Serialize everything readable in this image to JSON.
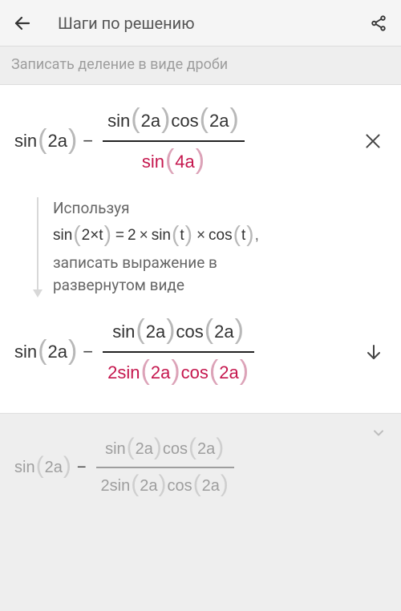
{
  "header": {
    "title": "Шаги по решению"
  },
  "hint": "Записать деление в виде дроби",
  "step1": {
    "lhs_fn": "sin",
    "lhs_arg": "2a",
    "num_fn1": "sin",
    "num_arg1": "2a",
    "num_fn2": "cos",
    "num_arg2": "2a",
    "den_fn": "sin",
    "den_arg": "4a"
  },
  "explain": {
    "line1": "Используя",
    "formula_lhs_fn": "sin",
    "formula_lhs_arg": "2×t",
    "eq": "=",
    "two": "2",
    "formula_r1_fn": "sin",
    "formula_r1_arg": "t",
    "formula_r2_fn": "cos",
    "formula_r2_arg": "t",
    "line2a": "записать выражение в",
    "line2b": "развернутом виде"
  },
  "step2": {
    "lhs_fn": "sin",
    "lhs_arg": "2a",
    "num_fn1": "sin",
    "num_arg1": "2a",
    "num_fn2": "cos",
    "num_arg2": "2a",
    "den_coef": "2",
    "den_fn1": "sin",
    "den_arg1": "2a",
    "den_fn2": "cos",
    "den_arg2": "2a"
  },
  "footer": {
    "lhs_fn": "sin",
    "lhs_arg": "2a",
    "num_fn1": "sin",
    "num_arg1": "2a",
    "num_fn2": "cos",
    "num_arg2": "2a",
    "den_coef": "2",
    "den_fn1": "sin",
    "den_arg1": "2a",
    "den_fn2": "cos",
    "den_arg2": "2a"
  }
}
